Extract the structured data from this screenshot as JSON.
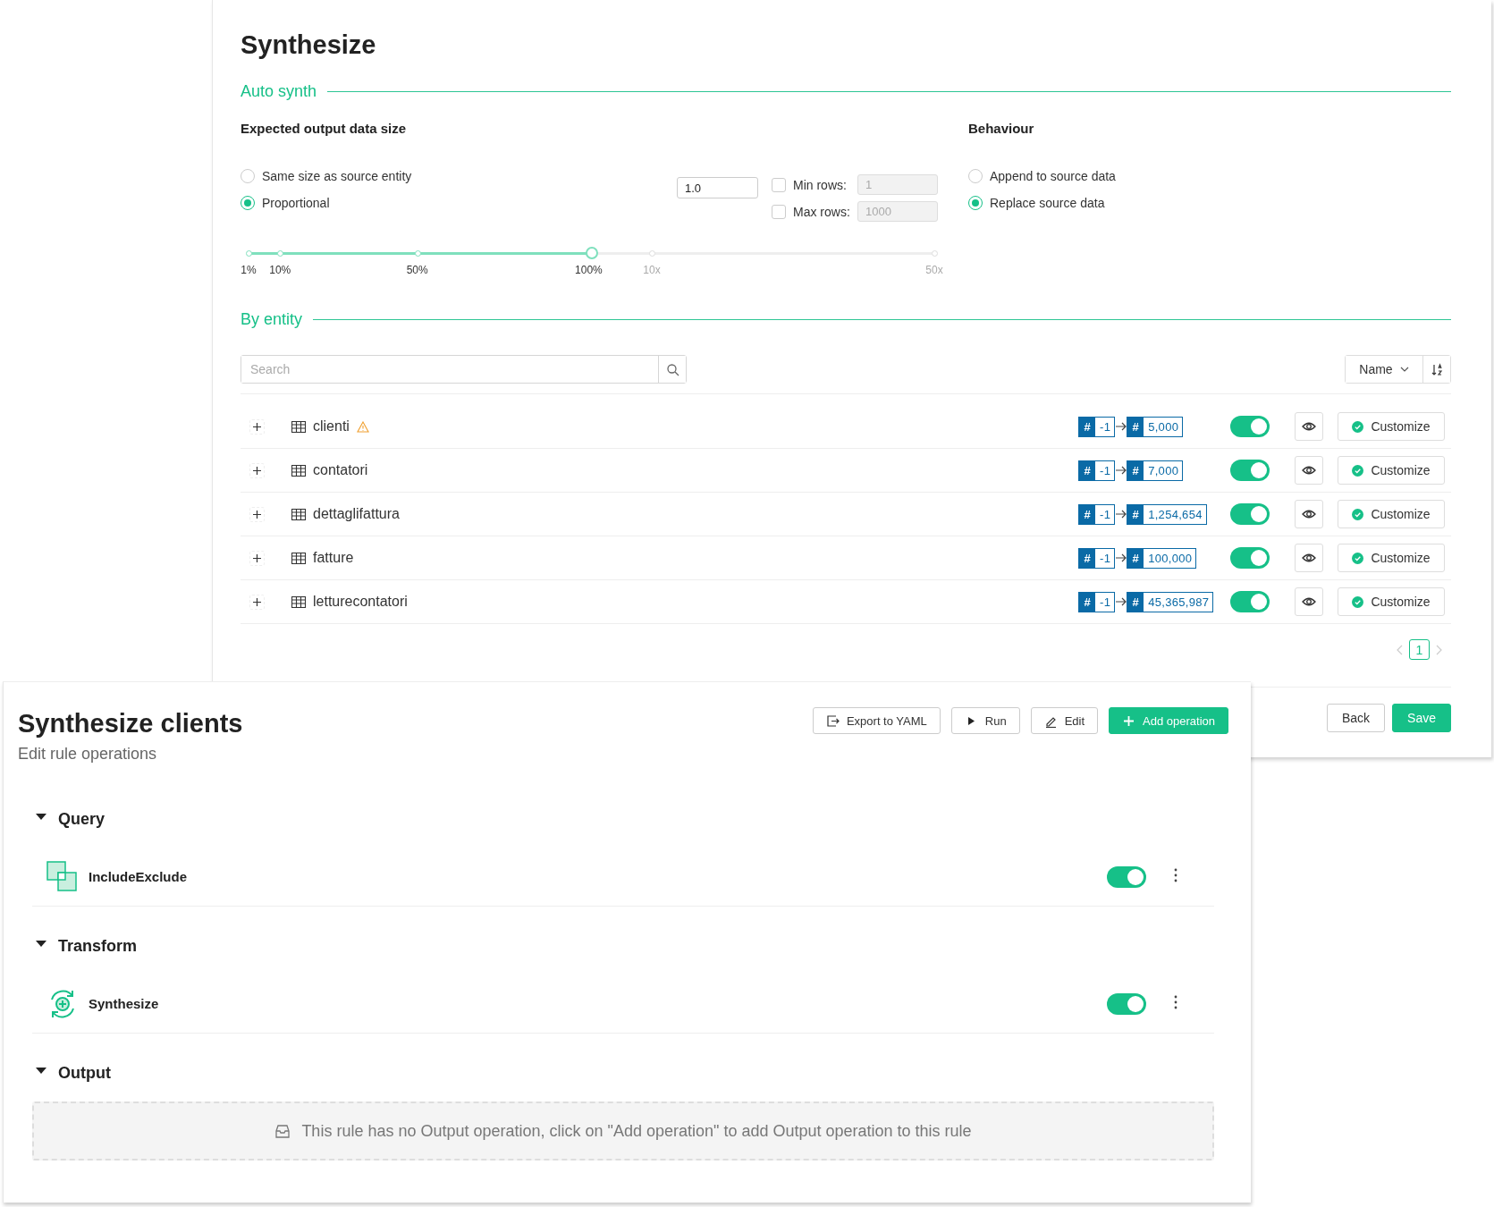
{
  "synth_window": {
    "title": "Synthesize",
    "auto_synth": {
      "heading": "Auto synth",
      "output_size": {
        "heading": "Expected output data size",
        "options": [
          {
            "label": "Same size as source entity",
            "selected": false
          },
          {
            "label": "Proportional",
            "selected": true
          }
        ],
        "ratio": "1.0",
        "limits": [
          {
            "label": "Min rows:",
            "checked": false,
            "value": "1"
          },
          {
            "label": "Max rows:",
            "checked": false,
            "value": "1000"
          }
        ],
        "slider": {
          "level": 0.5,
          "marks": [
            "1%",
            "10%",
            "50%",
            "100%",
            "10x",
            "50x"
          ]
        }
      },
      "behaviour": {
        "heading": "Behaviour",
        "options": [
          {
            "label": "Append to source data",
            "selected": false
          },
          {
            "label": "Replace source data",
            "selected": true
          }
        ]
      }
    },
    "by_entity": {
      "heading": "By entity",
      "search": {
        "placeholder": "Search"
      },
      "sort": {
        "label": "Name"
      },
      "entities": [
        {
          "name": "clienti",
          "warning": true,
          "hash_from": "#",
          "source": "-1",
          "hash_to": "#",
          "target": "5,000",
          "on": true,
          "action": "Customize"
        },
        {
          "name": "contatori",
          "warning": false,
          "hash_from": "#",
          "source": "-1",
          "hash_to": "#",
          "target": "7,000",
          "on": true,
          "action": "Customize"
        },
        {
          "name": "dettaglifattura",
          "warning": false,
          "hash_from": "#",
          "source": "-1",
          "hash_to": "#",
          "target": "1,254,654",
          "on": true,
          "action": "Customize"
        },
        {
          "name": "fatture",
          "warning": false,
          "hash_from": "#",
          "source": "-1",
          "hash_to": "#",
          "target": "100,000",
          "on": true,
          "action": "Customize"
        },
        {
          "name": "letturecontatori",
          "warning": false,
          "hash_from": "#",
          "source": "-1",
          "hash_to": "#",
          "target": "45,365,987",
          "on": true,
          "action": "Customize"
        }
      ],
      "pages": [
        {
          "label": "1",
          "selected": true
        }
      ]
    },
    "buttons": [
      {
        "label": "Back",
        "kind": "secondary"
      },
      {
        "label": "Save",
        "kind": "primary"
      }
    ]
  },
  "rule_window": {
    "title": "Synthesize clients",
    "subtitle": "Edit rule operations",
    "buttons": [
      {
        "label": "Export to YAML",
        "kind": "export"
      },
      {
        "label": "Run",
        "kind": "run"
      },
      {
        "label": "Edit",
        "kind": "edit"
      },
      {
        "label": "Add operation",
        "kind": "add"
      }
    ],
    "sections": [
      {
        "title": "Query",
        "expanded": true,
        "operations": [
          {
            "name": "IncludeExclude",
            "kind": "include-exclude",
            "on": true
          }
        ]
      },
      {
        "title": "Transform",
        "expanded": true,
        "operations": [
          {
            "name": "Synthesize",
            "kind": "synthesize",
            "on": true
          }
        ]
      },
      {
        "title": "Output",
        "expanded": true,
        "empty_message": "This rule has no Output operation, click on \"Add operation\" to add Output operation to this rule"
      }
    ]
  }
}
